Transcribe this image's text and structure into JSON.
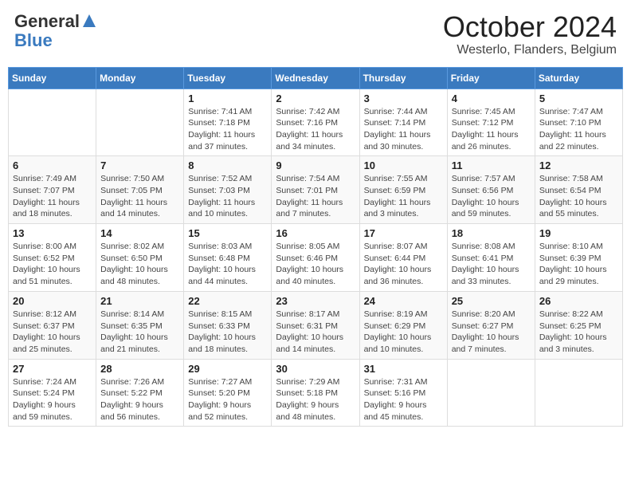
{
  "header": {
    "logo_general": "General",
    "logo_blue": "Blue",
    "title": "October 2024",
    "location": "Westerlo, Flanders, Belgium"
  },
  "weekdays": [
    "Sunday",
    "Monday",
    "Tuesday",
    "Wednesday",
    "Thursday",
    "Friday",
    "Saturday"
  ],
  "weeks": [
    [
      {
        "day": "",
        "sunrise": "",
        "sunset": "",
        "daylight": ""
      },
      {
        "day": "",
        "sunrise": "",
        "sunset": "",
        "daylight": ""
      },
      {
        "day": "1",
        "sunrise": "Sunrise: 7:41 AM",
        "sunset": "Sunset: 7:18 PM",
        "daylight": "Daylight: 11 hours and 37 minutes."
      },
      {
        "day": "2",
        "sunrise": "Sunrise: 7:42 AM",
        "sunset": "Sunset: 7:16 PM",
        "daylight": "Daylight: 11 hours and 34 minutes."
      },
      {
        "day": "3",
        "sunrise": "Sunrise: 7:44 AM",
        "sunset": "Sunset: 7:14 PM",
        "daylight": "Daylight: 11 hours and 30 minutes."
      },
      {
        "day": "4",
        "sunrise": "Sunrise: 7:45 AM",
        "sunset": "Sunset: 7:12 PM",
        "daylight": "Daylight: 11 hours and 26 minutes."
      },
      {
        "day": "5",
        "sunrise": "Sunrise: 7:47 AM",
        "sunset": "Sunset: 7:10 PM",
        "daylight": "Daylight: 11 hours and 22 minutes."
      }
    ],
    [
      {
        "day": "6",
        "sunrise": "Sunrise: 7:49 AM",
        "sunset": "Sunset: 7:07 PM",
        "daylight": "Daylight: 11 hours and 18 minutes."
      },
      {
        "day": "7",
        "sunrise": "Sunrise: 7:50 AM",
        "sunset": "Sunset: 7:05 PM",
        "daylight": "Daylight: 11 hours and 14 minutes."
      },
      {
        "day": "8",
        "sunrise": "Sunrise: 7:52 AM",
        "sunset": "Sunset: 7:03 PM",
        "daylight": "Daylight: 11 hours and 10 minutes."
      },
      {
        "day": "9",
        "sunrise": "Sunrise: 7:54 AM",
        "sunset": "Sunset: 7:01 PM",
        "daylight": "Daylight: 11 hours and 7 minutes."
      },
      {
        "day": "10",
        "sunrise": "Sunrise: 7:55 AM",
        "sunset": "Sunset: 6:59 PM",
        "daylight": "Daylight: 11 hours and 3 minutes."
      },
      {
        "day": "11",
        "sunrise": "Sunrise: 7:57 AM",
        "sunset": "Sunset: 6:56 PM",
        "daylight": "Daylight: 10 hours and 59 minutes."
      },
      {
        "day": "12",
        "sunrise": "Sunrise: 7:58 AM",
        "sunset": "Sunset: 6:54 PM",
        "daylight": "Daylight: 10 hours and 55 minutes."
      }
    ],
    [
      {
        "day": "13",
        "sunrise": "Sunrise: 8:00 AM",
        "sunset": "Sunset: 6:52 PM",
        "daylight": "Daylight: 10 hours and 51 minutes."
      },
      {
        "day": "14",
        "sunrise": "Sunrise: 8:02 AM",
        "sunset": "Sunset: 6:50 PM",
        "daylight": "Daylight: 10 hours and 48 minutes."
      },
      {
        "day": "15",
        "sunrise": "Sunrise: 8:03 AM",
        "sunset": "Sunset: 6:48 PM",
        "daylight": "Daylight: 10 hours and 44 minutes."
      },
      {
        "day": "16",
        "sunrise": "Sunrise: 8:05 AM",
        "sunset": "Sunset: 6:46 PM",
        "daylight": "Daylight: 10 hours and 40 minutes."
      },
      {
        "day": "17",
        "sunrise": "Sunrise: 8:07 AM",
        "sunset": "Sunset: 6:44 PM",
        "daylight": "Daylight: 10 hours and 36 minutes."
      },
      {
        "day": "18",
        "sunrise": "Sunrise: 8:08 AM",
        "sunset": "Sunset: 6:41 PM",
        "daylight": "Daylight: 10 hours and 33 minutes."
      },
      {
        "day": "19",
        "sunrise": "Sunrise: 8:10 AM",
        "sunset": "Sunset: 6:39 PM",
        "daylight": "Daylight: 10 hours and 29 minutes."
      }
    ],
    [
      {
        "day": "20",
        "sunrise": "Sunrise: 8:12 AM",
        "sunset": "Sunset: 6:37 PM",
        "daylight": "Daylight: 10 hours and 25 minutes."
      },
      {
        "day": "21",
        "sunrise": "Sunrise: 8:14 AM",
        "sunset": "Sunset: 6:35 PM",
        "daylight": "Daylight: 10 hours and 21 minutes."
      },
      {
        "day": "22",
        "sunrise": "Sunrise: 8:15 AM",
        "sunset": "Sunset: 6:33 PM",
        "daylight": "Daylight: 10 hours and 18 minutes."
      },
      {
        "day": "23",
        "sunrise": "Sunrise: 8:17 AM",
        "sunset": "Sunset: 6:31 PM",
        "daylight": "Daylight: 10 hours and 14 minutes."
      },
      {
        "day": "24",
        "sunrise": "Sunrise: 8:19 AM",
        "sunset": "Sunset: 6:29 PM",
        "daylight": "Daylight: 10 hours and 10 minutes."
      },
      {
        "day": "25",
        "sunrise": "Sunrise: 8:20 AM",
        "sunset": "Sunset: 6:27 PM",
        "daylight": "Daylight: 10 hours and 7 minutes."
      },
      {
        "day": "26",
        "sunrise": "Sunrise: 8:22 AM",
        "sunset": "Sunset: 6:25 PM",
        "daylight": "Daylight: 10 hours and 3 minutes."
      }
    ],
    [
      {
        "day": "27",
        "sunrise": "Sunrise: 7:24 AM",
        "sunset": "Sunset: 5:24 PM",
        "daylight": "Daylight: 9 hours and 59 minutes."
      },
      {
        "day": "28",
        "sunrise": "Sunrise: 7:26 AM",
        "sunset": "Sunset: 5:22 PM",
        "daylight": "Daylight: 9 hours and 56 minutes."
      },
      {
        "day": "29",
        "sunrise": "Sunrise: 7:27 AM",
        "sunset": "Sunset: 5:20 PM",
        "daylight": "Daylight: 9 hours and 52 minutes."
      },
      {
        "day": "30",
        "sunrise": "Sunrise: 7:29 AM",
        "sunset": "Sunset: 5:18 PM",
        "daylight": "Daylight: 9 hours and 48 minutes."
      },
      {
        "day": "31",
        "sunrise": "Sunrise: 7:31 AM",
        "sunset": "Sunset: 5:16 PM",
        "daylight": "Daylight: 9 hours and 45 minutes."
      },
      {
        "day": "",
        "sunrise": "",
        "sunset": "",
        "daylight": ""
      },
      {
        "day": "",
        "sunrise": "",
        "sunset": "",
        "daylight": ""
      }
    ]
  ]
}
